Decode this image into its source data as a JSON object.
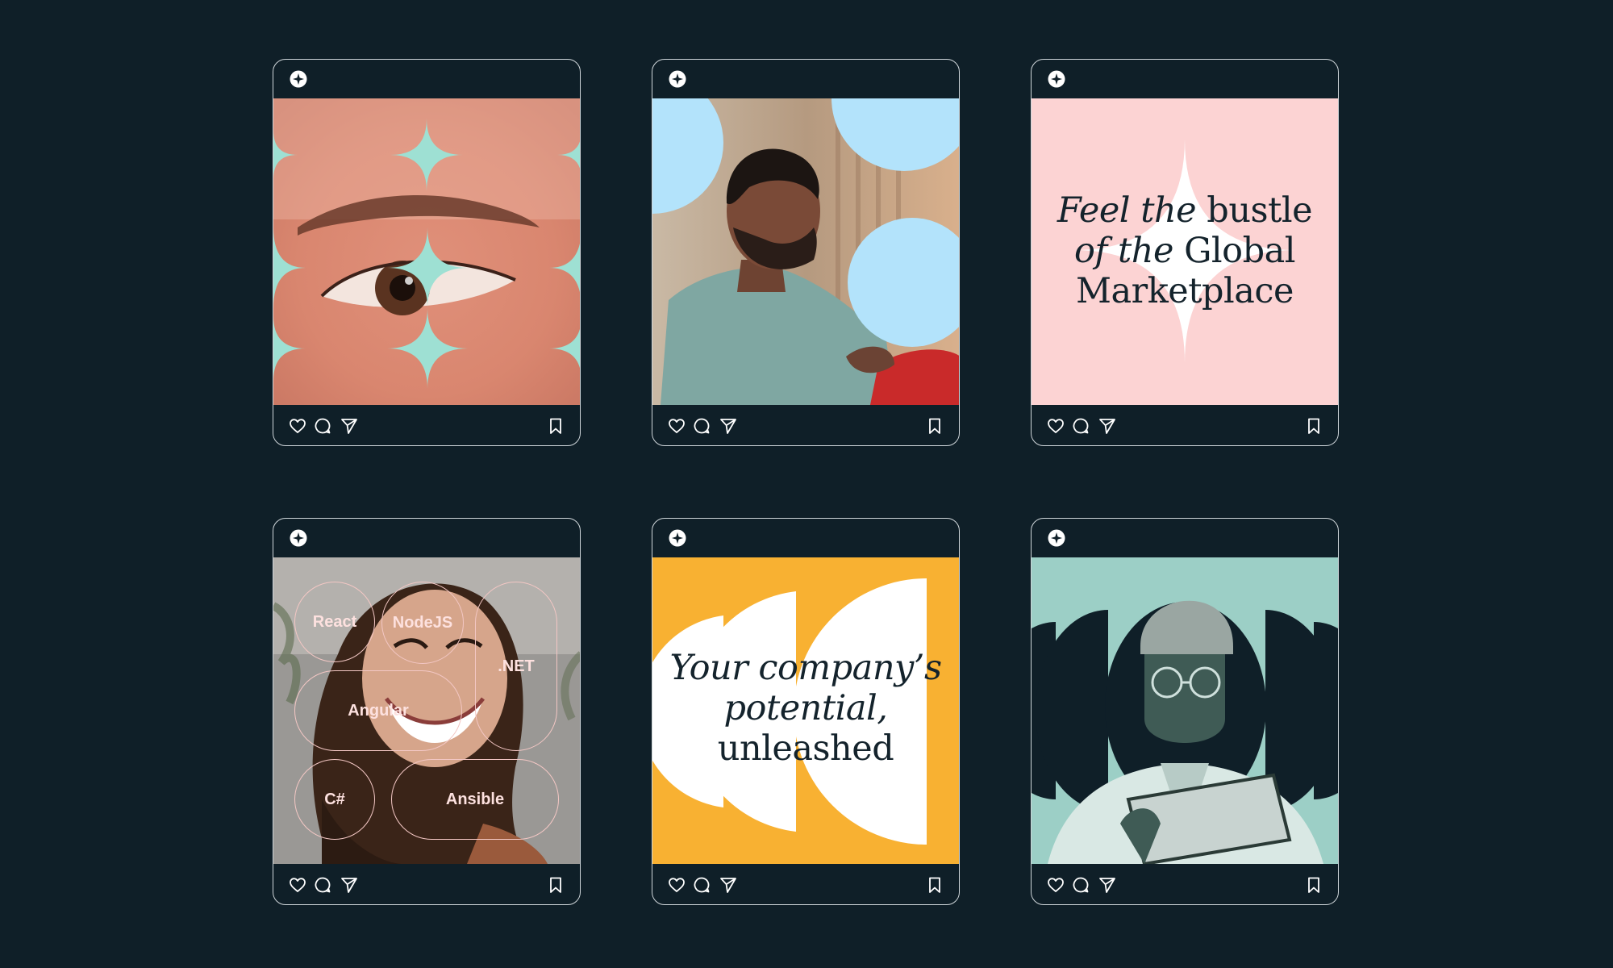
{
  "colors": {
    "background": "#0f1f28",
    "card_border": "#cfd6da",
    "mint": "#9ee0d3",
    "sky": "#b3e3fb",
    "pink": "#fcd3d3",
    "orange": "#f8b132",
    "sage": "#9ccfc6"
  },
  "posts": [
    {
      "logo": "brand-logo-icon",
      "image": "close-up eye photo with mint four-point sparkle shapes",
      "actions": [
        "heart-icon",
        "comment-icon",
        "send-icon",
        "bookmark-icon"
      ]
    },
    {
      "logo": "brand-logo-icon",
      "image": "bearded man looking out window with light-blue circles",
      "actions": [
        "heart-icon",
        "comment-icon",
        "send-icon",
        "bookmark-icon"
      ]
    },
    {
      "logo": "brand-logo-icon",
      "caption": {
        "line1_italic": "Feel the",
        "line1_roman": " bustle",
        "line2_italic": "of the",
        "line2_roman": " Global",
        "line3": "Marketplace"
      },
      "actions": [
        "heart-icon",
        "comment-icon",
        "send-icon",
        "bookmark-icon"
      ]
    },
    {
      "logo": "brand-logo-icon",
      "image": "smiling woman with technology pill labels",
      "tags": [
        "React",
        "NodeJS",
        ".NET",
        "Angular",
        "C#",
        "Ansible"
      ],
      "actions": [
        "heart-icon",
        "comment-icon",
        "send-icon",
        "bookmark-icon"
      ]
    },
    {
      "logo": "brand-logo-icon",
      "caption": {
        "line1": "Your company’s",
        "line2": "potential,",
        "line3": "unleashed"
      },
      "actions": [
        "heart-icon",
        "comment-icon",
        "send-icon",
        "bookmark-icon"
      ]
    },
    {
      "logo": "brand-logo-icon",
      "image": "man in beanie and glasses reading tablet over dark half circles",
      "actions": [
        "heart-icon",
        "comment-icon",
        "send-icon",
        "bookmark-icon"
      ]
    }
  ]
}
